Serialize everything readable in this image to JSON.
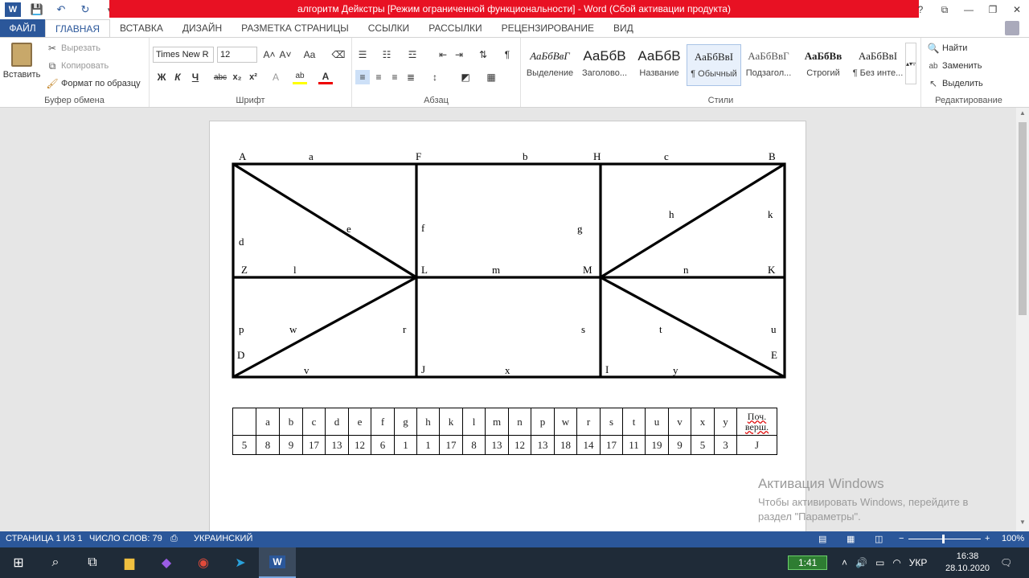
{
  "titlebar": {
    "title": "алгоритм Дейкстры [Режим ограниченной функциональности] -  Word (Сбой активации продукта)",
    "controls": {
      "help": "?",
      "restore_ribbon": "⧉",
      "minimize": "—",
      "maximize": "❐",
      "close": "✕"
    }
  },
  "tabs": [
    "ФАЙЛ",
    "ГЛАВНАЯ",
    "ВСТАВКА",
    "ДИЗАЙН",
    "РАЗМЕТКА СТРАНИЦЫ",
    "ССЫЛКИ",
    "РАССЫЛКИ",
    "РЕЦЕНЗИРОВАНИЕ",
    "ВИД"
  ],
  "ribbon": {
    "clipboard": {
      "paste": "Вставить",
      "cut": "Вырезать",
      "copy": "Копировать",
      "format_painter": "Формат по образцу",
      "label": "Буфер обмена"
    },
    "font": {
      "name": "Times New R",
      "size": "12",
      "label": "Шрифт",
      "bold": "Ж",
      "italic": "К",
      "underline": "Ч",
      "strike": "abc",
      "sub": "x₂",
      "sup": "x²",
      "grow": "A˄",
      "shrink": "A˅",
      "case": "Aa",
      "effects": "A",
      "highlight": "ab",
      "color": "A"
    },
    "paragraph": {
      "label": "Абзац"
    },
    "styles": {
      "label": "Стили",
      "items": [
        {
          "preview": "АаБбВвГ",
          "name": "Выделение"
        },
        {
          "preview": "АаБбВ",
          "name": "Заголово..."
        },
        {
          "preview": "АаБбВ",
          "name": "Название"
        },
        {
          "preview": "АаБбВвI",
          "name": "¶ Обычный"
        },
        {
          "preview": "АаБбВвГ",
          "name": "Подзагол..."
        },
        {
          "preview": "АаБбВв",
          "name": "Строгий"
        },
        {
          "preview": "АаБбВвI",
          "name": "¶ Без инте..."
        }
      ]
    },
    "editing": {
      "find": "Найти",
      "replace": "Заменить",
      "select": "Выделить",
      "label": "Редактирование"
    }
  },
  "graph": {
    "labels": {
      "A": "A",
      "a": "a",
      "F": "F",
      "b": "b",
      "H": "H",
      "c": "c",
      "B": "B",
      "d": "d",
      "e": "e",
      "f": "f",
      "g": "g",
      "h": "h",
      "k": "k",
      "Z": "Z",
      "l": "l",
      "L": "L",
      "m": "m",
      "M": "M",
      "n": "n",
      "K": "K",
      "p": "p",
      "w": "w",
      "r": "r",
      "s": "s",
      "t": "t",
      "u": "u",
      "D": "D",
      "E": "E",
      "v": "v",
      "J": "J",
      "x": "x",
      "I": "I",
      "y": "y"
    }
  },
  "table": {
    "headers": [
      "",
      "a",
      "b",
      "c",
      "d",
      "e",
      "f",
      "g",
      "h",
      "k",
      "l",
      "m",
      "n",
      "p",
      "w",
      "r",
      "s",
      "t",
      "u",
      "v",
      "x",
      "y",
      "Поч. верш."
    ],
    "values": [
      "5",
      "8",
      "9",
      "17",
      "13",
      "12",
      "6",
      "1",
      "1",
      "17",
      "8",
      "13",
      "12",
      "13",
      "18",
      "14",
      "17",
      "11",
      "19",
      "9",
      "5",
      "3",
      "J"
    ]
  },
  "watermark": {
    "title": "Активация Windows",
    "line1": "Чтобы активировать Windows, перейдите в",
    "line2": "раздел \"Параметры\"."
  },
  "statusbar": {
    "page": "СТРАНИЦА 1 ИЗ 1",
    "words": "ЧИСЛО СЛОВ: 79",
    "language": "УКРАИНСКИЙ",
    "zoom": "100%"
  },
  "taskbar": {
    "timer": "1:41",
    "lang": "УКР",
    "time": "16:38",
    "date": "28.10.2020"
  }
}
